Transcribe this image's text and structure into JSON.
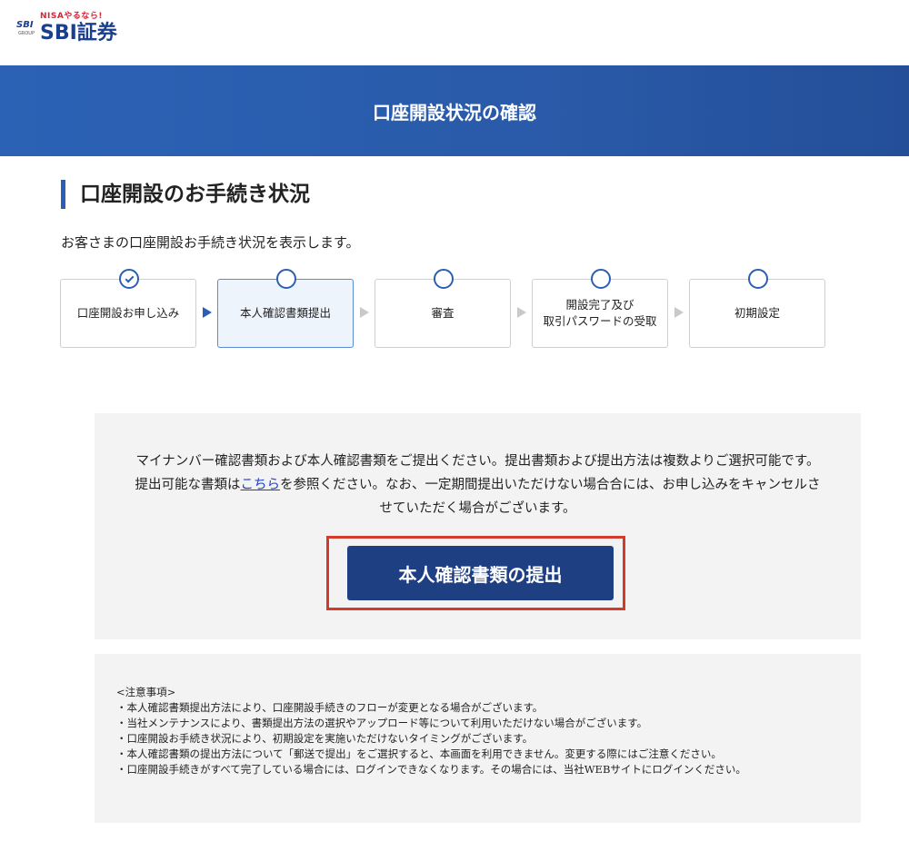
{
  "header": {
    "logo_tagline": "NISAやるなら!",
    "logo_group_mark": "SBI",
    "logo_group_caption": "GROUP",
    "logo_name": "SBI証券"
  },
  "banner": {
    "title": "口座開設状況の確認"
  },
  "section": {
    "title": "口座開設のお手続き状況",
    "intro": "お客さまの口座開設お手続き状況を表示します。"
  },
  "steps": [
    {
      "label": "口座開設お申し込み",
      "state": "completed"
    },
    {
      "label": "本人確認書類提出",
      "state": "current"
    },
    {
      "label": "審査",
      "state": "pending"
    },
    {
      "label_line1": "開設完了及び",
      "label_line2": "取引パスワードの受取",
      "state": "pending"
    },
    {
      "label": "初期設定",
      "state": "pending"
    }
  ],
  "notice": {
    "text_before_link": "マイナンバー確認書類および本人確認書類をご提出ください。提出書類および提出方法は複数よりご選択可能です。提出可能な書類は",
    "link_text": "こちら",
    "text_after_link": "を参照ください。なお、一定期間提出いただけない場合合には、お申し込みをキャンセルさせていただく場合がございます。",
    "submit_label": "本人確認書類の提出"
  },
  "notes": {
    "heading": "<注意事項>",
    "items": [
      "・本人確認書類提出方法により、口座開設手続きのフローが変更となる場合がございます。",
      "・当社メンテナンスにより、書類提出方法の選択やアップロード等について利用いただけない場合がございます。",
      "・口座開設お手続き状況により、初期設定を実施いただけないタイミングがございます。",
      "・本人確認書類の提出方法について「郵送で提出」をご選択すると、本画面を利用できません。変更する際にはご注意ください。",
      "・口座開設手続きがすべて完了している場合には、ログインできなくなります。その場合には、当社WEBサイトにログインください。"
    ]
  },
  "colors": {
    "brand_blue": "#2b5fb3",
    "button_navy": "#1e3f82",
    "highlight_red": "#d23b2a",
    "link_blue": "#1a3fd0"
  }
}
